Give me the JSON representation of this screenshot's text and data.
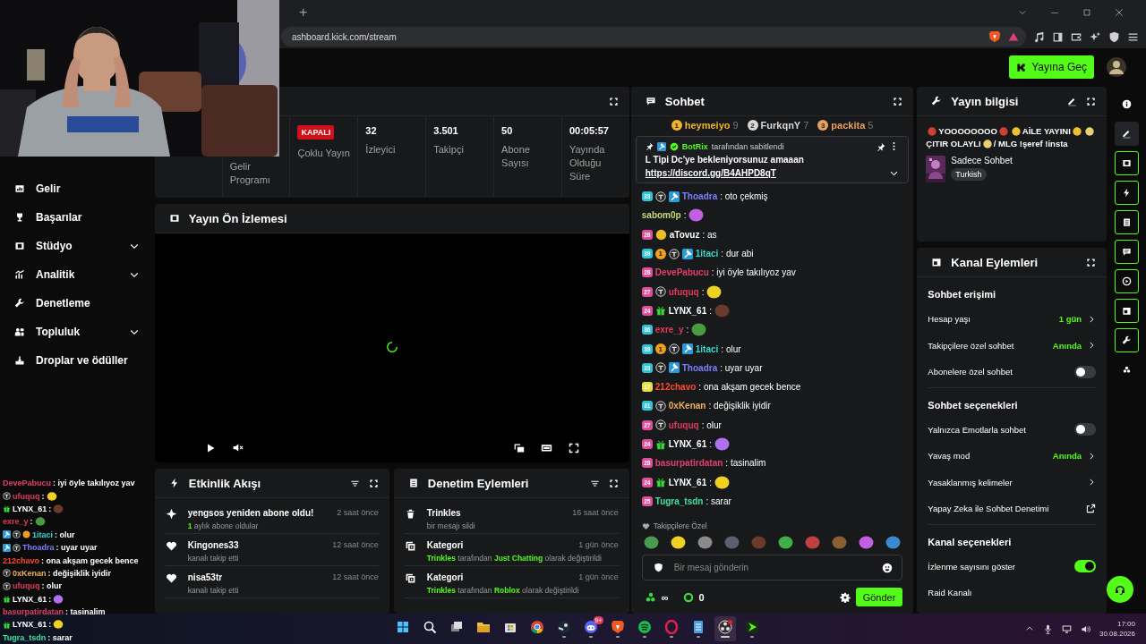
{
  "browser": {
    "new_tab": "+",
    "url": "ashboard.kick.com/stream"
  },
  "header": {
    "go_live": "Yayına Geç"
  },
  "sidebar": {
    "items": [
      {
        "label": "Gelir",
        "expandable": false
      },
      {
        "label": "Başarılar",
        "expandable": false
      },
      {
        "label": "Stüdyo",
        "expandable": true
      },
      {
        "label": "Analitik",
        "expandable": true
      },
      {
        "label": "Denetleme",
        "expandable": false
      },
      {
        "label": "Topluluk",
        "expandable": true
      },
      {
        "label": "Droplar ve ödüller",
        "expandable": false
      }
    ]
  },
  "stats_panel": {
    "cells": [
      {
        "kind": "blank"
      },
      {
        "kind": "label",
        "label": "Gelir Programı"
      },
      {
        "kind": "badge",
        "badge": "KAPALI",
        "label": "Çoklu Yayın"
      },
      {
        "kind": "value",
        "value": "32",
        "label": "İzleyici"
      },
      {
        "kind": "value",
        "value": "3.501",
        "label": "Takipçi"
      },
      {
        "kind": "value",
        "value": "50",
        "label": "Abone Sayısı"
      },
      {
        "kind": "value",
        "value": "00:05:57",
        "label": "Yayında Olduğu Süre"
      }
    ]
  },
  "preview": {
    "title": "Yayın Ön İzlemesi",
    "loading": true
  },
  "activity": {
    "title": "Etkinlik Akışı",
    "items": [
      {
        "kind": "resub",
        "title": "yengsos yeniden abone oldu!",
        "time": "2 saat önce",
        "detail": [
          {
            "text": "1",
            "highlight": true
          },
          {
            "text": " aylık abone oldular",
            "highlight": false
          }
        ]
      },
      {
        "kind": "follow",
        "title": "Kingones33",
        "time": "12 saat önce",
        "detail": [
          {
            "text": "kanalı takip etti",
            "highlight": false
          }
        ]
      },
      {
        "kind": "follow",
        "title": "nisa53tr",
        "time": "12 saat önce",
        "detail": [
          {
            "text": "kanalı takip etti",
            "highlight": false
          }
        ]
      }
    ]
  },
  "moderation": {
    "title": "Denetim Eylemleri",
    "items": [
      {
        "kind": "delete",
        "title": "Trinkles",
        "time": "16 saat önce",
        "detail": [
          {
            "text": "bir mesajı sildi",
            "highlight": false
          }
        ]
      },
      {
        "kind": "category",
        "title": "Kategori",
        "time": "1 gün önce",
        "detail": [
          {
            "text": "Trinkles",
            "highlight": true
          },
          {
            "text": " tarafından ",
            "highlight": false
          },
          {
            "text": "Just Chatting",
            "highlight": true
          },
          {
            "text": " olarak değiştirildi",
            "highlight": false
          }
        ]
      },
      {
        "kind": "category",
        "title": "Kategori",
        "time": "1 gün önce",
        "detail": [
          {
            "text": "Trinkles",
            "highlight": true
          },
          {
            "text": " tarafından ",
            "highlight": false
          },
          {
            "text": "Roblox",
            "highlight": true
          },
          {
            "text": " olarak değiştirildi",
            "highlight": false
          }
        ]
      }
    ]
  },
  "chat": {
    "title": "Sohbet",
    "leaders": [
      {
        "rank": "1",
        "name": "heymeiyo",
        "count": "9",
        "color": "#f0b429"
      },
      {
        "rank": "2",
        "name": "FurkqnY",
        "count": "7",
        "color": "#d8d8d8"
      },
      {
        "rank": "3",
        "name": "packita",
        "count": "5",
        "color": "#e8a060"
      }
    ],
    "pinned": {
      "by": "BotRix",
      "note": "tarafından sabitlendi",
      "text": "L Tipi Dc'ye bekleniyorsunuz amaaan",
      "link": "https://discord.gg/B4AHPD8qT"
    },
    "messages": [
      {
        "badges": [
          {
            "kind": "sub",
            "label": "33",
            "color": "#2ec4d6"
          },
          {
            "kind": "og"
          },
          {
            "kind": "mod"
          }
        ],
        "user": "Thoadra",
        "color": "#7d7dff",
        "text": ": oto çekmiş"
      },
      {
        "user": "sabom0p",
        "color": "#c6d67a",
        "text": ":",
        "emote": {
          "color": "#c060e0"
        }
      },
      {
        "badges": [
          {
            "kind": "sub",
            "label": "28",
            "color": "#e0509a"
          },
          {
            "kind": "emote",
            "color": "#e8c020"
          }
        ],
        "user": "aTovuz",
        "color": "#ffffff",
        "text": ": as"
      },
      {
        "badges": [
          {
            "kind": "sub",
            "label": "39",
            "color": "#2ec4d6"
          },
          {
            "kind": "coin",
            "label": "1"
          },
          {
            "kind": "og"
          },
          {
            "kind": "mod"
          }
        ],
        "user": "1itaci",
        "color": "#36d8d0",
        "text": ": dur abi"
      },
      {
        "badges": [
          {
            "kind": "sub",
            "label": "28",
            "color": "#e0509a"
          }
        ],
        "user": "DevePabucu",
        "color": "#e0406a",
        "text": ": iyi öyle takılıyoz yav"
      },
      {
        "badges": [
          {
            "kind": "sub",
            "label": "27",
            "color": "#e0509a"
          },
          {
            "kind": "og"
          }
        ],
        "user": "ufuquq",
        "color": "#e03a5a",
        "text": ":",
        "emote": {
          "color": "#f0d020"
        }
      },
      {
        "badges": [
          {
            "kind": "sub",
            "label": "24",
            "color": "#e0509a"
          },
          {
            "kind": "gift"
          }
        ],
        "user": "LYNX_61",
        "color": "#ffffff",
        "text": ":",
        "emote": {
          "color": "#6a3a2a"
        }
      },
      {
        "badges": [
          {
            "kind": "sub",
            "label": "36",
            "color": "#2ec4d6"
          }
        ],
        "user": "exre_y",
        "color": "#e03a5a",
        "text": ":",
        "emote": {
          "color": "#4a9a40"
        }
      },
      {
        "badges": [
          {
            "kind": "sub",
            "label": "39",
            "color": "#2ec4d6"
          },
          {
            "kind": "coin",
            "label": "1"
          },
          {
            "kind": "og"
          },
          {
            "kind": "mod"
          }
        ],
        "user": "1itaci",
        "color": "#36d8d0",
        "text": ": olur"
      },
      {
        "badges": [
          {
            "kind": "sub",
            "label": "33",
            "color": "#2ec4d6"
          },
          {
            "kind": "og"
          },
          {
            "kind": "mod"
          }
        ],
        "user": "Thoadra",
        "color": "#7d7dff",
        "text": ": uyar uyar"
      },
      {
        "badges": [
          {
            "kind": "sub",
            "label": "17",
            "color": "#e8e040"
          }
        ],
        "user": "212chavo",
        "color": "#ff4a2a",
        "text": ": ona akşam gecek bence"
      },
      {
        "badges": [
          {
            "kind": "sub",
            "label": "31",
            "color": "#2ec4d6"
          },
          {
            "kind": "og"
          }
        ],
        "user": "0xKenan",
        "color": "#f0b060",
        "text": ": değişiklik iyidir"
      },
      {
        "badges": [
          {
            "kind": "sub",
            "label": "27",
            "color": "#e0509a"
          },
          {
            "kind": "og"
          }
        ],
        "user": "ufuquq",
        "color": "#e03a5a",
        "text": ": olur"
      },
      {
        "badges": [
          {
            "kind": "sub",
            "label": "24",
            "color": "#e0509a"
          },
          {
            "kind": "gift"
          }
        ],
        "user": "LYNX_61",
        "color": "#ffffff",
        "text": ":",
        "emote": {
          "color": "#b070f0"
        }
      },
      {
        "badges": [
          {
            "kind": "sub",
            "label": "28",
            "color": "#e0509a"
          }
        ],
        "user": "basurpatirdatan",
        "color": "#e0406a",
        "text": ": tasinalim"
      },
      {
        "badges": [
          {
            "kind": "sub",
            "label": "24",
            "color": "#e0509a"
          },
          {
            "kind": "gift"
          }
        ],
        "user": "LYNX_61",
        "color": "#ffffff",
        "text": ":",
        "emote": {
          "color": "#f0d020"
        }
      },
      {
        "badges": [
          {
            "kind": "sub",
            "label": "25",
            "color": "#e0509a"
          }
        ],
        "user": "Tugra_tsdn",
        "color": "#40e0a0",
        "text": ": sarar"
      }
    ],
    "emote_bar": {
      "label": "Takipçilere Özel",
      "emotes": [
        {
          "color": "#4a9a50"
        },
        {
          "color": "#f0d020"
        },
        {
          "color": "#8a8a8a"
        },
        {
          "color": "#5a6070"
        },
        {
          "color": "#6a3a2a"
        },
        {
          "color": "#3fae4a"
        },
        {
          "color": "#c04040"
        },
        {
          "color": "#8a6030"
        },
        {
          "color": "#c060e0"
        },
        {
          "color": "#3a8ad0"
        }
      ]
    },
    "input": {
      "placeholder": "Bir mesaj gönderin"
    },
    "footer": {
      "points": "∞",
      "kicks": "0",
      "send": "Gönder"
    }
  },
  "stream_info": {
    "title": "Yayın bilgisi",
    "stream_title": [
      {
        "kind": "emoji",
        "color": "#d04030"
      },
      {
        "kind": "text",
        "text": "YOOOOOOOO"
      },
      {
        "kind": "emoji",
        "color": "#d04030"
      },
      {
        "kind": "emoji",
        "color": "#f0c030"
      },
      {
        "kind": "text",
        "text": "AİLE YAYINI"
      },
      {
        "kind": "emoji",
        "color": "#f0c030"
      },
      {
        "kind": "emoji",
        "color": "#e8d070"
      },
      {
        "kind": "text",
        "text": "ÇITIR OLAYLI"
      },
      {
        "kind": "emoji",
        "color": "#e8d070"
      },
      {
        "kind": "text",
        "text": "/ MLG !şeref !insta"
      }
    ],
    "category": "Sadece Sohbet",
    "tag": "Turkish"
  },
  "channel_actions": {
    "title": "Kanal Eylemleri",
    "sections": [
      {
        "title": "Sohbet erişimi",
        "rows": [
          {
            "kind": "nav",
            "label": "Hesap yaşı",
            "value": "1 gün"
          },
          {
            "kind": "nav",
            "label": "Takipçilere özel sohbet",
            "value": "Anında"
          },
          {
            "kind": "toggle",
            "label": "Abonelere özel sohbet",
            "on": false
          }
        ]
      },
      {
        "title": "Sohbet seçenekleri",
        "rows": [
          {
            "kind": "toggle",
            "label": "Yalnızca Emotlarla sohbet",
            "on": false
          },
          {
            "kind": "nav",
            "label": "Yavaş mod",
            "value": "Anında"
          },
          {
            "kind": "nav",
            "label": "Yasaklanmış kelimeler"
          },
          {
            "kind": "external",
            "label": "Yapay Zeka ile Sohbet Denetimi"
          }
        ]
      },
      {
        "title": "Kanal seçenekleri",
        "rows": [
          {
            "kind": "toggle",
            "label": "İzlenme sayısını göster",
            "on": true
          },
          {
            "kind": "plain",
            "label": "Raid Kanalı"
          }
        ]
      }
    ]
  },
  "rail": [
    {
      "selected": false,
      "active": false
    },
    {
      "selected": true,
      "active": false
    },
    {
      "selected": false,
      "active": true
    },
    {
      "selected": false,
      "active": true
    },
    {
      "selected": false,
      "active": true
    },
    {
      "selected": false,
      "active": true
    },
    {
      "selected": false,
      "active": true
    },
    {
      "selected": false,
      "active": true
    },
    {
      "selected": false,
      "active": true
    },
    {
      "selected": false,
      "active": false
    }
  ],
  "chat_overlay": [
    {
      "user": "DevePabucu",
      "color": "#e0406a",
      "text": ": iyi öyle takılıyoz yav"
    },
    {
      "badges": [
        {
          "kind": "og"
        }
      ],
      "user": "ufuquq",
      "color": "#e03a5a",
      "text": ":",
      "emote": {
        "color": "#f0d020"
      }
    },
    {
      "badges": [
        {
          "kind": "gift"
        }
      ],
      "user": "LYNX_61",
      "color": "#ffffff",
      "text": ":",
      "emote": {
        "color": "#6a3a2a"
      }
    },
    {
      "user": "exre_y",
      "color": "#e03a5a",
      "text": ":",
      "emote": {
        "color": "#4a9a40"
      }
    },
    {
      "badges": [
        {
          "kind": "mod"
        },
        {
          "kind": "og"
        },
        {
          "kind": "coin"
        }
      ],
      "user": "1itaci",
      "color": "#36d8d0",
      "text": ": olur"
    },
    {
      "badges": [
        {
          "kind": "mod"
        },
        {
          "kind": "og"
        }
      ],
      "user": "Thoadra",
      "color": "#7d7dff",
      "text": ": uyar uyar"
    },
    {
      "user": "212chavo",
      "color": "#ff4a2a",
      "text": ": ona akşam gecek bence"
    },
    {
      "badges": [
        {
          "kind": "og"
        }
      ],
      "user": "0xKenan",
      "color": "#f0b060",
      "text": ": değişiklik iyidir"
    },
    {
      "badges": [
        {
          "kind": "og"
        }
      ],
      "user": "ufuquq",
      "color": "#e03a5a",
      "text": ": olur"
    },
    {
      "badges": [
        {
          "kind": "gift"
        }
      ],
      "user": "LYNX_61",
      "color": "#ffffff",
      "text": ":",
      "emote": {
        "color": "#b070f0"
      }
    },
    {
      "user": "basurpatirdatan",
      "color": "#e0406a",
      "text": ": tasinalim"
    },
    {
      "badges": [
        {
          "kind": "gift"
        }
      ],
      "user": "LYNX_61",
      "color": "#ffffff",
      "text": ":",
      "emote": {
        "color": "#f0d020"
      }
    },
    {
      "user": "Tugra_tsdn",
      "color": "#40e0a0",
      "text": ": sarar"
    }
  ],
  "taskbar": {
    "apps": [
      {
        "running": false,
        "active": false
      },
      {
        "running": false,
        "active": false
      },
      {
        "running": false,
        "active": false
      },
      {
        "running": false,
        "active": false
      },
      {
        "running": false,
        "active": false
      },
      {
        "running": false,
        "active": false
      },
      {
        "running": true,
        "active": false
      },
      {
        "running": true,
        "active": false,
        "badge": "9+"
      },
      {
        "running": true,
        "active": false
      },
      {
        "running": true,
        "active": false
      },
      {
        "running": true,
        "active": false
      },
      {
        "running": true,
        "active": false
      },
      {
        "running": true,
        "active": true
      },
      {
        "running": true,
        "active": false
      }
    ],
    "clock": {
      "time": "17:00",
      "date": "30.08.2026"
    }
  }
}
